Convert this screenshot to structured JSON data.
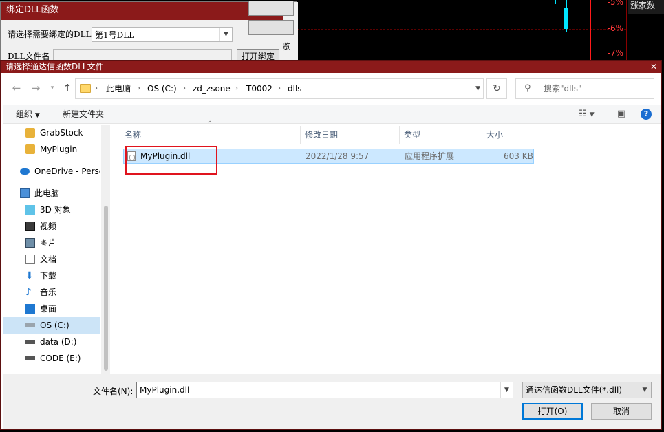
{
  "background": {
    "right_header": "涨家数",
    "pct_labels": [
      "-5%",
      "-6%",
      "-7%"
    ],
    "partial_text": "览"
  },
  "bind_dialog": {
    "title": "绑定DLL函数",
    "prompt": "请选择需要绑定的DLL",
    "selected_dll": "第1号DLL",
    "file_label": "DLL文件名",
    "bind_button": "打开绑定"
  },
  "file_dialog": {
    "title": "请选择通达信函数DLL文件",
    "breadcrumb": [
      "此电脑",
      "OS (C:)",
      "zd_zsone",
      "T0002",
      "dlls"
    ],
    "search_placeholder": "搜索\"dlls\"",
    "toolbar": {
      "organize": "组织",
      "new_folder": "新建文件夹"
    },
    "sidebar": [
      {
        "label": "GrabStock",
        "icon": "warning-folder-icon"
      },
      {
        "label": "MyPlugin",
        "icon": "warning-folder-icon"
      },
      {
        "label": "OneDrive - Perso",
        "icon": "onedrive-icon"
      },
      {
        "label": "此电脑",
        "icon": "computer-icon"
      },
      {
        "label": "3D 对象",
        "icon": "3d-objects-icon"
      },
      {
        "label": "视频",
        "icon": "video-icon"
      },
      {
        "label": "图片",
        "icon": "pictures-icon"
      },
      {
        "label": "文档",
        "icon": "documents-icon"
      },
      {
        "label": "下载",
        "icon": "downloads-icon"
      },
      {
        "label": "音乐",
        "icon": "music-icon"
      },
      {
        "label": "桌面",
        "icon": "desktop-icon"
      },
      {
        "label": "OS (C:)",
        "icon": "drive-icon"
      },
      {
        "label": "data (D:)",
        "icon": "drive-icon"
      },
      {
        "label": "CODE (E:)",
        "icon": "drive-icon"
      }
    ],
    "columns": [
      "名称",
      "修改日期",
      "类型",
      "大小"
    ],
    "files": [
      {
        "name": "MyPlugin.dll",
        "modified": "2022/1/28 9:57",
        "type": "应用程序扩展",
        "size": "603 KB"
      }
    ],
    "filename_label": "文件名(N):",
    "filename_value": "MyPlugin.dll",
    "filetype": "通达信函数DLL文件(*.dll)",
    "open_button": "打开(O)",
    "cancel_button": "取消"
  }
}
